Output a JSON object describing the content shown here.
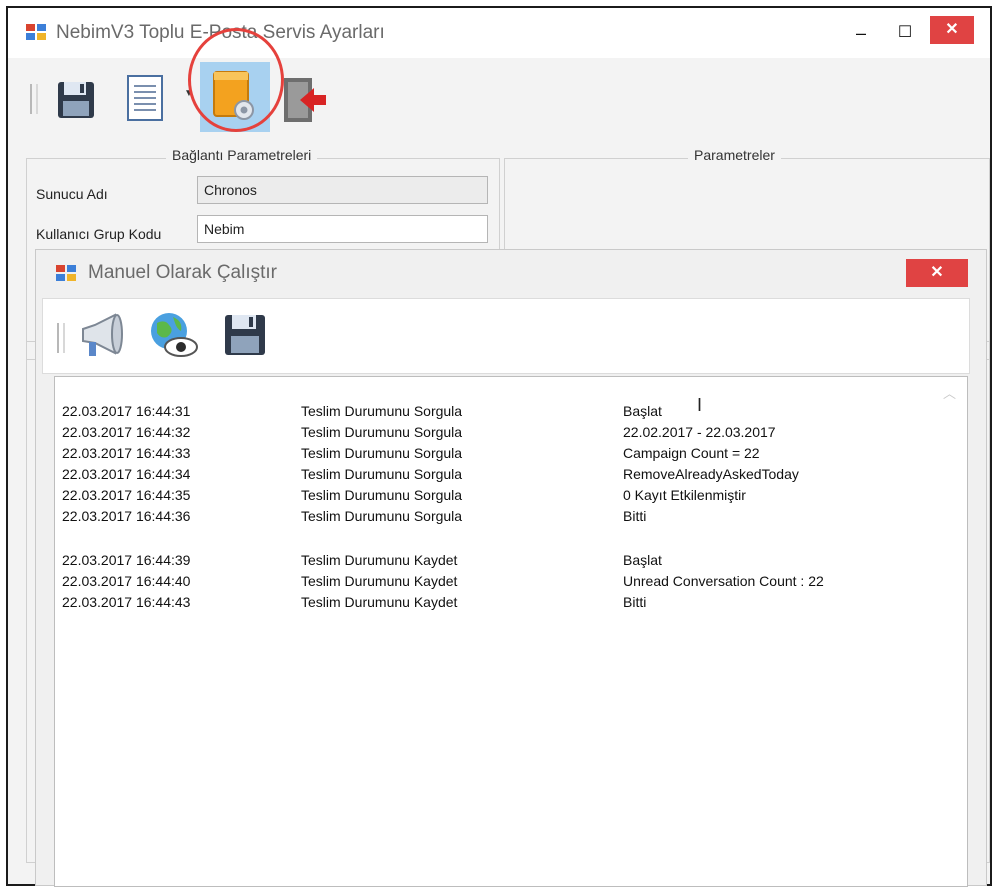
{
  "main_window": {
    "title": "NebimV3 Toplu E-Posta Servis Ayarları",
    "controls": {
      "minimize": "–",
      "maximize": "☐",
      "close": "✕"
    },
    "toolbar": {
      "buttons": [
        "save-icon",
        "report-icon",
        "settings-icon",
        "exit-icon"
      ]
    },
    "connection_group": {
      "legend": "Bağlantı Parametreleri",
      "server_label": "Sunucu Adı",
      "server_value": "Chronos",
      "group_code_label": "Kullanıcı Grup Kodu",
      "group_code_value": "Nebim"
    },
    "params_group": {
      "legend": "Parametreler"
    }
  },
  "dialog": {
    "title": "Manuel Olarak Çalıştır",
    "close": "✕",
    "toolbar": {
      "buttons": [
        "megaphone-icon",
        "globe-eye-icon",
        "save-icon"
      ]
    },
    "log": [
      {
        "time": "22.03.2017 16:44:31",
        "action": "Teslim Durumunu Sorgula",
        "message": "Başlat"
      },
      {
        "time": "22.03.2017 16:44:32",
        "action": "Teslim Durumunu Sorgula",
        "message": "22.02.2017 - 22.03.2017"
      },
      {
        "time": "22.03.2017 16:44:33",
        "action": "Teslim Durumunu Sorgula",
        "message": "Campaign Count = 22"
      },
      {
        "time": "22.03.2017 16:44:34",
        "action": "Teslim Durumunu Sorgula",
        "message": "RemoveAlreadyAskedToday"
      },
      {
        "time": "22.03.2017 16:44:35",
        "action": "Teslim Durumunu Sorgula",
        "message": "0 Kayıt Etkilenmiştir"
      },
      {
        "time": "22.03.2017 16:44:36",
        "action": "Teslim Durumunu Sorgula",
        "message": "Bitti"
      },
      {
        "time": "22.03.2017 16:44:39",
        "action": "Teslim Durumunu Kaydet",
        "message": "Başlat"
      },
      {
        "time": "22.03.2017 16:44:40",
        "action": "Teslim Durumunu Kaydet",
        "message": "Unread Conversation Count : 22"
      },
      {
        "time": "22.03.2017 16:44:43",
        "action": "Teslim Durumunu Kaydet",
        "message": "Bitti"
      }
    ]
  },
  "colors": {
    "highlight": "#e5413c",
    "active_button": "#a8d1f0",
    "close_button": "#e04343"
  }
}
